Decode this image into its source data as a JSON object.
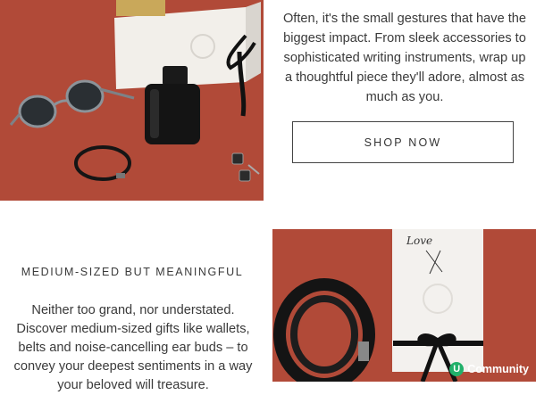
{
  "top_section": {
    "description": "Often, it's the small gestures that have the biggest impact. From sleek accessories to sophisticated writing instruments, wrap up a thoughtful piece they'll adore, almost as much as you.",
    "button_label": "SHOP NOW"
  },
  "mid_section": {
    "heading": "MEDIUM-SIZED BUT MEANINGFUL",
    "description": "Neither too grand, nor understated. Discover medium-sized gifts like wallets, belts and noise-cancelling ear buds – to convey your deepest sentiments in a way your beloved will treasure."
  },
  "card_text": "Love",
  "badge": {
    "letter": "U",
    "label": "Community"
  },
  "colors": {
    "terracotta": "#b14a38",
    "badge_green": "#21b06a"
  }
}
